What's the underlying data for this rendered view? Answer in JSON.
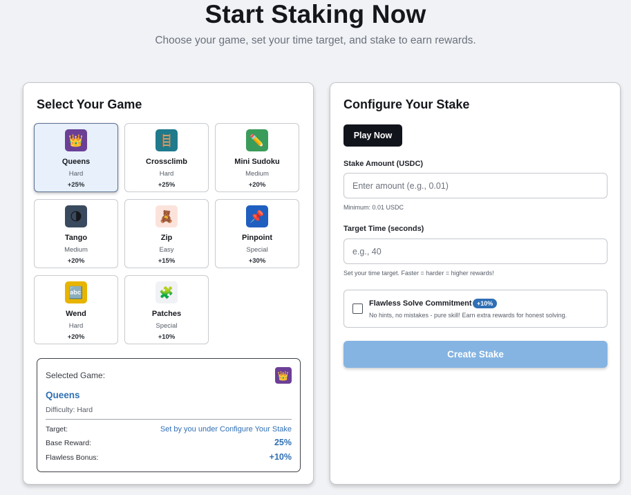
{
  "header": {
    "title": "Start Staking Now",
    "subtitle": "Choose your game, set your time target, and stake to earn rewards."
  },
  "game_panel": {
    "title": "Select Your Game",
    "games": [
      {
        "name": "Queens",
        "difficulty": "Hard",
        "bonus": "+25%",
        "icon": "crown-icon",
        "glyph": "👑",
        "color": "#6c3f97",
        "selected": true
      },
      {
        "name": "Crossclimb",
        "difficulty": "Hard",
        "bonus": "+25%",
        "icon": "ladder-icon",
        "glyph": "🪜",
        "color": "#1f7a8c"
      },
      {
        "name": "Mini Sudoku",
        "difficulty": "Medium",
        "bonus": "+20%",
        "icon": "pencil-icon",
        "glyph": "✏️",
        "color": "#3a9c5a"
      },
      {
        "name": "Tango",
        "difficulty": "Medium",
        "bonus": "+20%",
        "icon": "sun-moon-icon",
        "glyph": "🌗",
        "color": "#3a4a5e"
      },
      {
        "name": "Zip",
        "difficulty": "Easy",
        "bonus": "+15%",
        "icon": "zip-character-icon",
        "glyph": "🧸",
        "color": "#fbe3dc"
      },
      {
        "name": "Pinpoint",
        "difficulty": "Special",
        "bonus": "+30%",
        "icon": "pin-star-icon",
        "glyph": "📌",
        "color": "#1f5fc0"
      },
      {
        "name": "Wend",
        "difficulty": "Hard",
        "bonus": "+20%",
        "icon": "letter-grid-icon",
        "glyph": "🔤",
        "color": "#e8b400"
      },
      {
        "name": "Patches",
        "difficulty": "Special",
        "bonus": "+10%",
        "icon": "patches-character-icon",
        "glyph": "🧩",
        "color": "#f1f2f5"
      }
    ],
    "selected": {
      "label": "Selected Game:",
      "name": "Queens",
      "difficulty": "Difficulty: Hard",
      "target_label": "Target:",
      "target_value": "Set by you under Configure Your Stake",
      "base_reward_label": "Base Reward:",
      "base_reward_value": "25%",
      "flawless_bonus_label": "Flawless Bonus:",
      "flawless_bonus_value": "+10%"
    }
  },
  "config_panel": {
    "title": "Configure Your Stake",
    "play_now": "Play Now",
    "stake_amount": {
      "label": "Stake Amount (USDC)",
      "placeholder": "Enter amount (e.g., 0.01)",
      "value": "",
      "help": "Minimum: 0.01 USDC"
    },
    "target_time": {
      "label": "Target Time (seconds)",
      "placeholder": "e.g., 40",
      "value": "",
      "help": "Set your time target. Faster = harder = higher rewards!"
    },
    "flawless": {
      "title": "Flawless Solve Commitment",
      "badge": "+10%",
      "description": "No hints, no mistakes - pure skill! Earn extra rewards for honest solving.",
      "checked": false
    },
    "create_stake": "Create Stake"
  }
}
